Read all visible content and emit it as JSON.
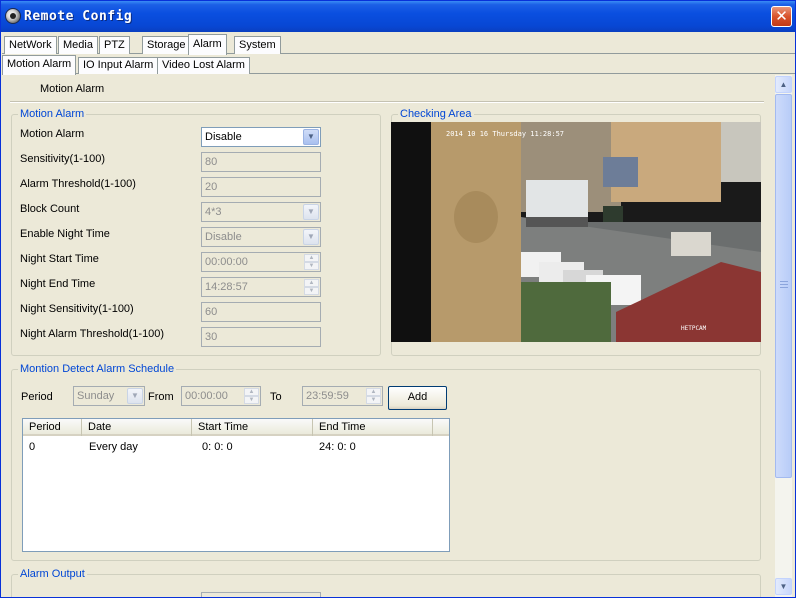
{
  "window": {
    "title": "Remote Config",
    "close_glyph": "✕"
  },
  "tabs_main": [
    {
      "label": "NetWork"
    },
    {
      "label": "Media"
    },
    {
      "label": "PTZ"
    },
    {
      "label": "Storage"
    },
    {
      "label": "Alarm",
      "active": true
    },
    {
      "label": "System"
    }
  ],
  "tabs_sub": [
    {
      "label": "Motion Alarm",
      "active": true
    },
    {
      "label": "IO Input Alarm"
    },
    {
      "label": "Video Lost Alarm"
    }
  ],
  "page_heading": "Motion Alarm",
  "motion_group": {
    "legend": "Motion Alarm",
    "fields": [
      {
        "label": "Motion Alarm",
        "value": "Disable",
        "kind": "dropdown",
        "enabled": true
      },
      {
        "label": "Sensitivity(1-100)",
        "value": "80",
        "kind": "text"
      },
      {
        "label": "Alarm Threshold(1-100)",
        "value": "20",
        "kind": "text"
      },
      {
        "label": "Block Count",
        "value": "4*3",
        "kind": "dropdown"
      },
      {
        "label": "Enable Night Time",
        "value": "Disable",
        "kind": "dropdown"
      },
      {
        "label": "Night Start Time",
        "value": "00:00:00",
        "kind": "spin"
      },
      {
        "label": "Night End Time",
        "value": "14:28:57",
        "kind": "spin"
      },
      {
        "label": "Night Sensitivity(1-100)",
        "value": "60",
        "kind": "text"
      },
      {
        "label": "Night Alarm Threshold(1-100)",
        "value": "30",
        "kind": "text"
      }
    ]
  },
  "checking_area": {
    "legend": "Checking Area",
    "osd_time": "2014 10 16 Thursday 11:28:57",
    "watermark": "HETPCAM"
  },
  "schedule": {
    "legend": "Montion Detect Alarm Schedule",
    "period_label": "Period",
    "period_value": "Sunday",
    "from_label": "From",
    "from_value": "00:00:00",
    "to_label": "To",
    "to_value": "23:59:59",
    "add_button": "Add",
    "columns": [
      "Period",
      "Date",
      "Start Time",
      "End Time"
    ],
    "rows": [
      {
        "period": "0",
        "date": "Every day",
        "start": "0: 0: 0",
        "end": "24: 0: 0"
      }
    ]
  },
  "alarm_output": {
    "legend": "Alarm Output"
  },
  "colors": {
    "titlebar": "#0a4fe0",
    "legend_text": "#0046d5",
    "window_bg": "#ece9d8"
  },
  "icons": {
    "app": "webcam-icon",
    "close": "close-icon",
    "dropdown": "chevron-down-icon",
    "spin": "spin-arrows-icon"
  }
}
